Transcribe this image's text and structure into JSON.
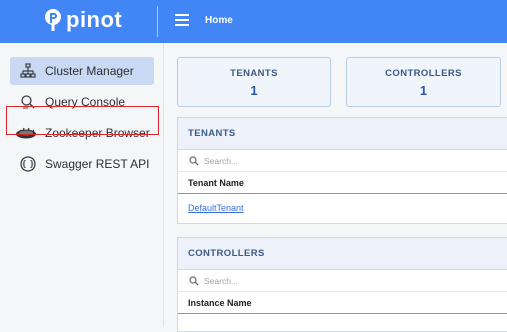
{
  "header": {
    "brand": "pinot",
    "breadcrumb": "Home",
    "colors": {
      "bar": "#4285f4",
      "text": "#ffffff"
    }
  },
  "sidebar": {
    "items": [
      {
        "label": "Cluster Manager",
        "icon": "cluster-icon",
        "active": true
      },
      {
        "label": "Query Console",
        "icon": "query-icon",
        "active": false
      },
      {
        "label": "Zookeeper Browser",
        "icon": "zookeeper-icon",
        "active": false
      },
      {
        "label": "Swagger REST API",
        "icon": "swagger-icon",
        "active": false,
        "highlighted": true
      }
    ]
  },
  "stats": [
    {
      "label": "TENANTS",
      "value": "1"
    },
    {
      "label": "CONTROLLERS",
      "value": "1"
    }
  ],
  "tenants_panel": {
    "title": "TENANTS",
    "search_placeholder": "Search...",
    "column": "Tenant Name",
    "rows": [
      "DefaultTenant"
    ]
  },
  "controllers_panel": {
    "title": "CONTROLLERS",
    "search_placeholder": "Search...",
    "column": "Instance Name",
    "rows": []
  }
}
